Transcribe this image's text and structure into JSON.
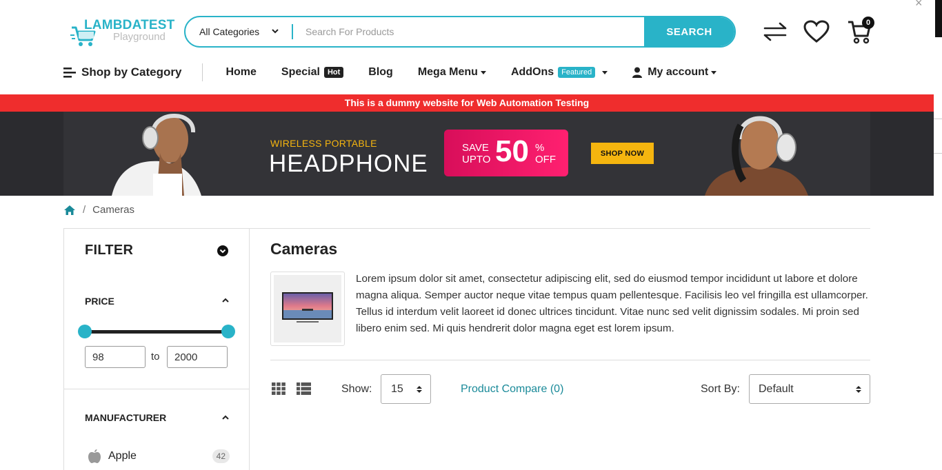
{
  "logo": {
    "brand": "LAMBDATEST",
    "sub": "Playground"
  },
  "search": {
    "category": "All Categories",
    "placeholder": "Search For Products",
    "button": "SEARCH"
  },
  "header_icons": {
    "compare": "compare-arrows-icon",
    "wishlist": "heart-icon",
    "cart": "cart-icon",
    "cart_count": "0"
  },
  "nav": {
    "shop_by_category": "Shop by Category",
    "home": "Home",
    "special": "Special",
    "special_badge": "Hot",
    "blog": "Blog",
    "mega_menu": "Mega Menu",
    "addons": "AddOns",
    "addons_badge": "Featured",
    "account": "My account"
  },
  "notice": "This is a dummy website for Web Automation Testing",
  "banner": {
    "subtitle": "WIRELESS PORTABLE",
    "title": "HEADPHONE",
    "save_line1": "SAVE",
    "save_line2": "UPTO",
    "percent": "50",
    "pct_sign": "%",
    "off": "OFF",
    "cta": "SHOP NOW"
  },
  "breadcrumb": {
    "current": "Cameras"
  },
  "filter": {
    "title": "FILTER",
    "price_title": "PRICE",
    "price_min": "98",
    "price_max": "2000",
    "to_label": "to",
    "manufacturer_title": "MANUFACTURER",
    "manufacturers": [
      {
        "name": "Apple",
        "count": "42"
      }
    ]
  },
  "main": {
    "title": "Cameras",
    "description": "Lorem ipsum dolor sit amet, consectetur adipiscing elit, sed do eiusmod tempor incididunt ut labore et dolore magna aliqua. Semper auctor neque vitae tempus quam pellentesque. Facilisis leo vel fringilla est ullamcorper. Tellus id interdum velit laoreet id donec ultrices tincidunt. Vitae nunc sed velit dignissim sodales. Mi proin sed libero enim sed. Mi quis hendrerit dolor magna eget est lorem ipsum.",
    "show_label": "Show:",
    "show_value": "15",
    "compare": "Product Compare (0)",
    "sort_label": "Sort By:",
    "sort_value": "Default"
  },
  "colors": {
    "accent": "#29b3c8",
    "notice": "#ef2d2d",
    "banner_yellow": "#f5b50f",
    "sale_pink": "#e8145f"
  }
}
